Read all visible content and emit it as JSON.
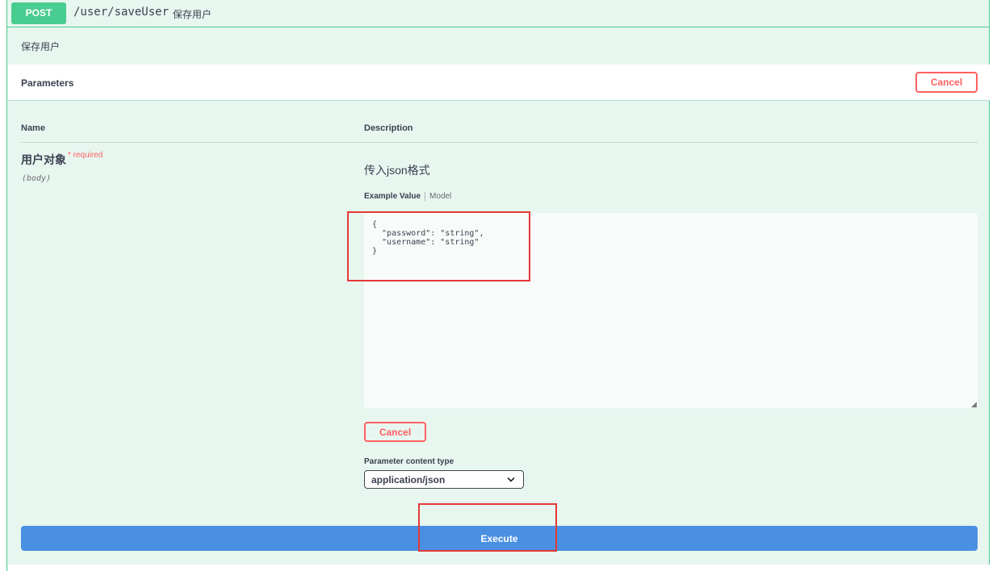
{
  "operation": {
    "method": "POST",
    "path": "/user/saveUser",
    "summary": "保存用户",
    "description": "保存用户"
  },
  "parameters": {
    "title": "Parameters",
    "cancel_label": "Cancel",
    "columns": {
      "name": "Name",
      "description": "Description"
    },
    "param": {
      "name": "用户对象",
      "required_mark": "* required",
      "in": "(body)",
      "description": "传入json格式",
      "tabs": {
        "example": "Example Value",
        "model": "Model"
      },
      "body_value": "{\n  \"password\": \"string\",\n  \"username\": \"string\"\n}"
    },
    "content_type": {
      "label": "Parameter content type",
      "selected": "application/json"
    }
  },
  "execute_label": "Execute",
  "colors": {
    "post_green": "#49cc90",
    "cancel_red": "#ff6060",
    "execute_blue": "#4990e2",
    "annotation_red": "#e53935"
  },
  "icons": {
    "select_arrow": "chevron-down-icon"
  }
}
